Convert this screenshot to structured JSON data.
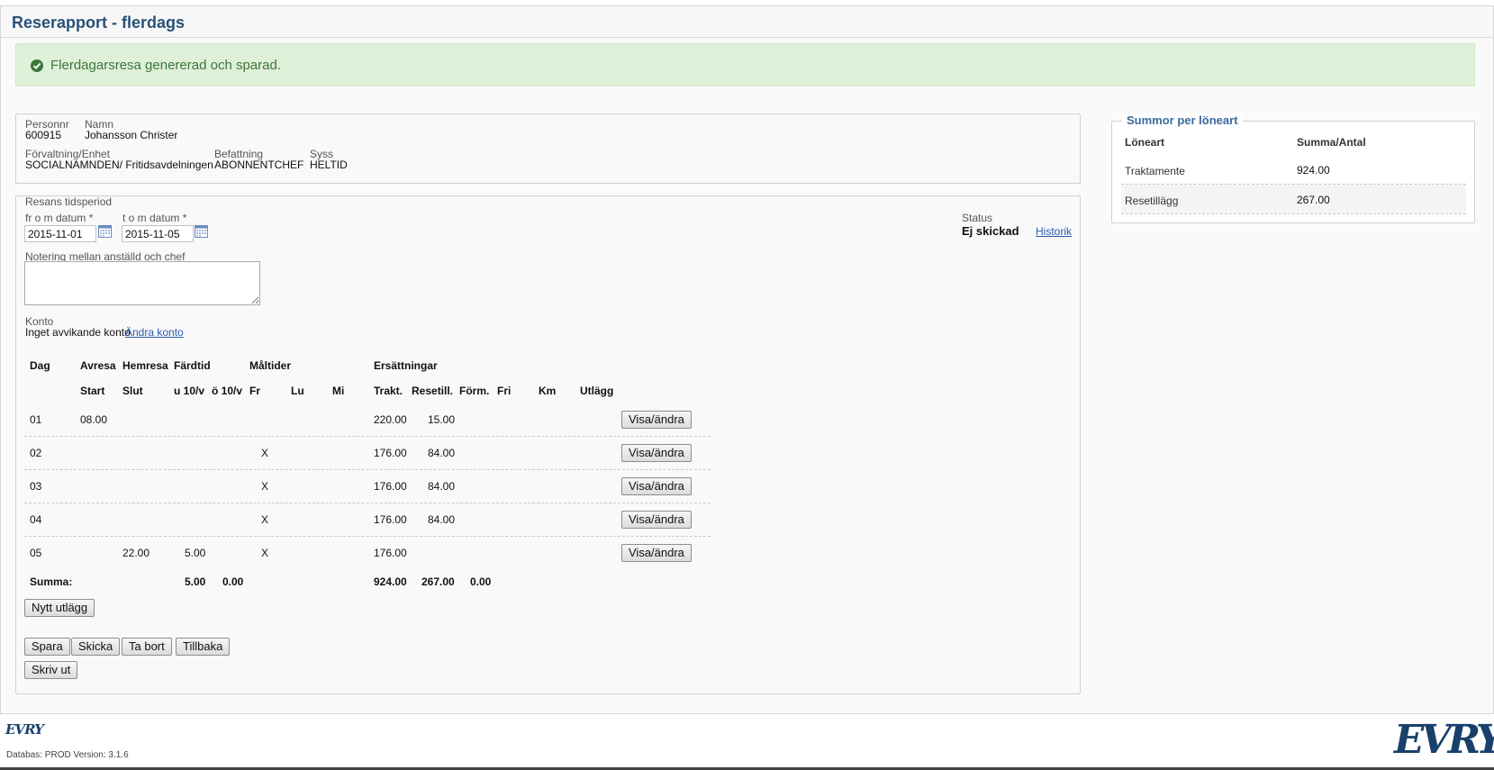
{
  "header": {
    "title": "Reserapport - flerdags"
  },
  "alert": {
    "icon": "check-circle-icon",
    "message": "Flerdagarsresa genererad och sparad.",
    "color": "#3c763d",
    "background": "#dff0d8"
  },
  "employee": {
    "personnr_label": "Personnr",
    "personnr": "600915",
    "namn_label": "Namn",
    "namn": "Johansson Christer",
    "forvaltning_label": "Förvaltning/Enhet",
    "forvaltning": "SOCIALNAMNDEN/ Fritidsavdelningen",
    "befattning_label": "Befattning",
    "befattning": "ABONNENTCHEF",
    "syss_label": "Syss",
    "syss": "HELTID"
  },
  "period": {
    "section_label": "Resans tidsperiod",
    "from_label": "fr o m datum *",
    "from_value": "2015-11-01",
    "to_label": "t o m datum *",
    "to_value": "2015-11-05",
    "status_label": "Status",
    "status_value": "Ej skickad",
    "historik_link": "Historik"
  },
  "note": {
    "label": "Notering mellan anställd och chef",
    "value": ""
  },
  "konto": {
    "label": "Konto",
    "text": "Inget avvikande konto",
    "link": "Ändra konto"
  },
  "table": {
    "group_headers": {
      "dag": "Dag",
      "avresa": "Avresa",
      "hemresa": "Hemresa",
      "fardtid": "Färdtid",
      "maltider": "Måltider",
      "ersattningar": "Ersättningar"
    },
    "sub_headers": {
      "start": "Start",
      "slut": "Slut",
      "u10": "u 10/v",
      "o10": "ö 10/v",
      "fr": "Fr",
      "lu": "Lu",
      "mi": "Mi",
      "trakt": "Trakt.",
      "resetill": "Resetill.",
      "form": "Förm.",
      "fri": "Fri",
      "km": "Km",
      "utlagg": "Utlägg"
    },
    "rows": [
      {
        "dag": "01",
        "start": "08.00",
        "slut": "",
        "u10": "",
        "fr": "",
        "trakt": "220.00",
        "resetill": "15.00",
        "action": "Visa/ändra"
      },
      {
        "dag": "02",
        "start": "",
        "slut": "",
        "u10": "",
        "fr": "X",
        "trakt": "176.00",
        "resetill": "84.00",
        "action": "Visa/ändra"
      },
      {
        "dag": "03",
        "start": "",
        "slut": "",
        "u10": "",
        "fr": "X",
        "trakt": "176.00",
        "resetill": "84.00",
        "action": "Visa/ändra"
      },
      {
        "dag": "04",
        "start": "",
        "slut": "",
        "u10": "",
        "fr": "X",
        "trakt": "176.00",
        "resetill": "84.00",
        "action": "Visa/ändra"
      },
      {
        "dag": "05",
        "start": "",
        "slut": "22.00",
        "u10": "5.00",
        "fr": "X",
        "trakt": "176.00",
        "resetill": "",
        "action": "Visa/ändra"
      }
    ],
    "summa": {
      "label": "Summa:",
      "u10": "5.00",
      "o10": "0.00",
      "trakt": "924.00",
      "resetill": "267.00",
      "form": "0.00"
    }
  },
  "buttons": {
    "nytt_utlagg": "Nytt utlägg",
    "spara": "Spara",
    "skicka": "Skicka",
    "ta_bort": "Ta bort",
    "tillbaka": "Tillbaka",
    "skriv_ut": "Skriv ut"
  },
  "summary": {
    "legend": "Summor per löneart",
    "col_loneart": "Löneart",
    "col_summa": "Summa/Antal",
    "rows": [
      {
        "loneart": "Traktamente",
        "summa": "924.00"
      },
      {
        "loneart": "Resetillägg",
        "summa": "267.00"
      }
    ]
  },
  "footer": {
    "logo_small": "EVRY",
    "version": "Databas: PROD Version: 3.1.6",
    "logo_big": "EVRY"
  }
}
